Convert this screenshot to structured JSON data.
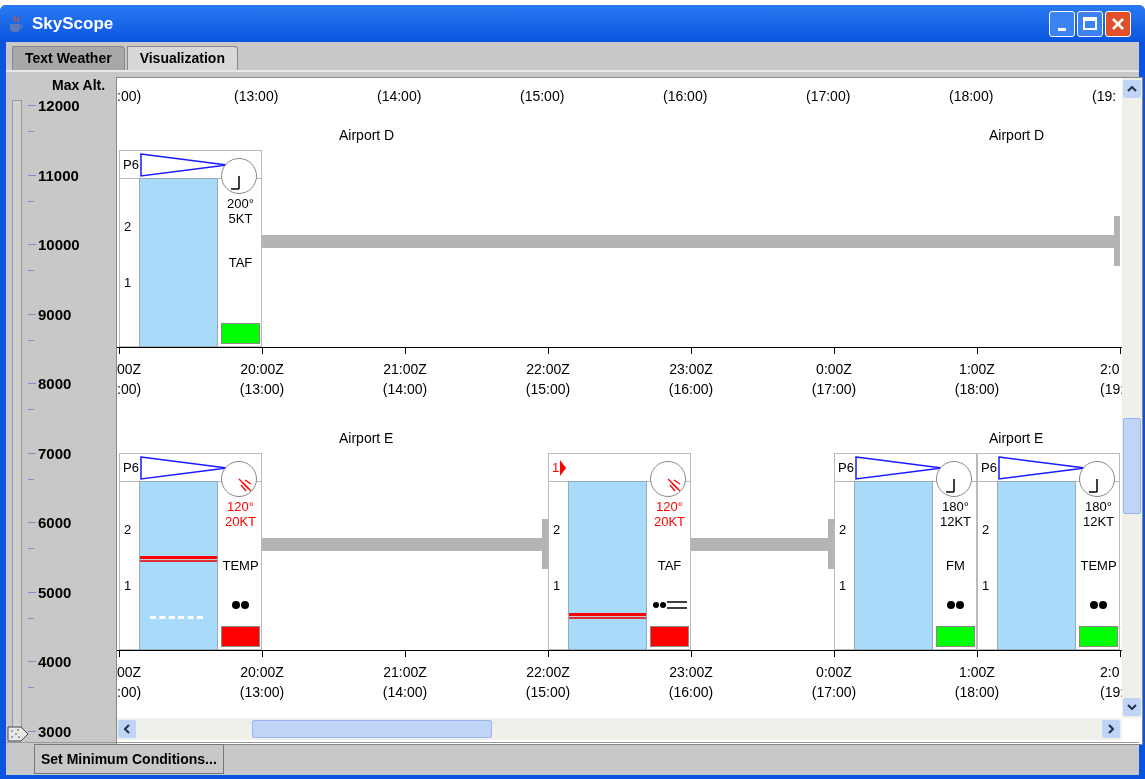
{
  "window": {
    "title": "SkyScope"
  },
  "tabs": [
    {
      "label": "Text Weather",
      "selected": false
    },
    {
      "label": "Visualization",
      "selected": true
    }
  ],
  "altitude": {
    "label": "Max Alt.",
    "ticks": [
      "12000",
      "11000",
      "10000",
      "9000",
      "8000",
      "7000",
      "6000",
      "5000",
      "4000",
      "3000"
    ],
    "level": 0
  },
  "top_axis_local": [
    ":00)",
    "(13:00)",
    "(14:00)",
    "(15:00)",
    "(16:00)",
    "(17:00)",
    "(18:00)",
    "(19:"
  ],
  "airports": [
    {
      "titles": [
        "Airport D",
        "Airport D"
      ],
      "stations": [
        {
          "header": "P6",
          "header_alert": false,
          "wind_dir": "200°",
          "wind_speed": "5KT",
          "wind_alert": false,
          "type": "TAF",
          "scale": [
            "2",
            "1"
          ],
          "color": "#00ff00"
        }
      ],
      "axis": [
        {
          "utc": "00Z",
          "local": ":00)"
        },
        {
          "utc": "20:00Z",
          "local": "(13:00)"
        },
        {
          "utc": "21:00Z",
          "local": "(14:00)"
        },
        {
          "utc": "22:00Z",
          "local": "(15:00)"
        },
        {
          "utc": "23:00Z",
          "local": "(16:00)"
        },
        {
          "utc": "0:00Z",
          "local": "(17:00)"
        },
        {
          "utc": "1:00Z",
          "local": "(18:00)"
        },
        {
          "utc": "2:0",
          "local": "(19:"
        }
      ]
    },
    {
      "titles": [
        "Airport E",
        "Airport E"
      ],
      "stations": [
        {
          "header": "P6",
          "header_alert": false,
          "wind_dir": "120°",
          "wind_speed": "20KT",
          "wind_alert": true,
          "type": "TEMP",
          "weather": {
            "kind": "rain"
          },
          "scale": [
            "2",
            "1"
          ],
          "color": "#ff0000",
          "layers": [
            {
              "kind": "ceiling",
              "level": 0.52
            },
            {
              "kind": "dashed",
              "level": 0.18
            }
          ]
        },
        {
          "header": "1",
          "header_alert": true,
          "wind_dir": "120°",
          "wind_speed": "20KT",
          "wind_alert": true,
          "type": "TAF",
          "weather": {
            "kind": "rain-fog"
          },
          "scale": [
            "2",
            "1"
          ],
          "color": "#ff0000",
          "layers": [
            {
              "kind": "ceiling",
              "level": 0.18
            }
          ]
        },
        {
          "header": "P6",
          "header_alert": false,
          "wind_dir": "180°",
          "wind_speed": "12KT",
          "wind_alert": false,
          "type": "FM",
          "weather": {
            "kind": "rain"
          },
          "scale": [
            "2",
            "1"
          ],
          "color": "#00ff00"
        },
        {
          "header": "P6",
          "header_alert": false,
          "wind_dir": "180°",
          "wind_speed": "12KT",
          "wind_alert": false,
          "type": "TEMP",
          "weather": {
            "kind": "rain"
          },
          "scale": [
            "2",
            "1"
          ],
          "color": "#00ff00"
        }
      ],
      "axis": [
        {
          "utc": "00Z",
          "local": ":00)"
        },
        {
          "utc": "20:00Z",
          "local": "(13:00)"
        },
        {
          "utc": "21:00Z",
          "local": "(14:00)"
        },
        {
          "utc": "22:00Z",
          "local": "(15:00)"
        },
        {
          "utc": "23:00Z",
          "local": "(16:00)"
        },
        {
          "utc": "0:00Z",
          "local": "(17:00)"
        },
        {
          "utc": "1:00Z",
          "local": "(18:00)"
        },
        {
          "utc": "2:0",
          "local": "(19:"
        }
      ]
    }
  ],
  "button": "Set Minimum Conditions..."
}
